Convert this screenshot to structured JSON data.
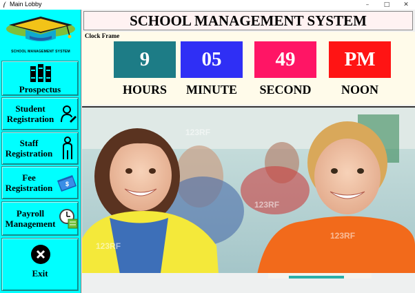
{
  "window": {
    "title": "Main Lobby",
    "minimize": "–",
    "maximize": "□",
    "close": "✕"
  },
  "logo": {
    "text": "SCHOOL MANAGEMENT SYSTEM",
    "icon": "graduation-cap-icon"
  },
  "sidebar": {
    "items": [
      {
        "label": "Prospectus",
        "icon": "books-icon"
      },
      {
        "label_line1": "Student",
        "label_line2": "Registration",
        "icon": "student-user-icon"
      },
      {
        "label_line1": "Staff",
        "label_line2": "Registration",
        "icon": "staff-person-icon"
      },
      {
        "label_line1": "Fee",
        "label_line2": "Registration",
        "icon": "money-icon"
      },
      {
        "label_line1": "Payroll",
        "label_line2": "Management",
        "icon": "clock-calendar-icon"
      },
      {
        "label": "Exit",
        "icon": "close-circle-icon"
      }
    ]
  },
  "header": {
    "title": "SCHOOL MANAGEMENT SYSTEM"
  },
  "clock": {
    "frame_title": "Clock Frame",
    "hours": "9",
    "minute": "05",
    "second": "49",
    "noon": "PM",
    "labels": {
      "hours": "HOURS",
      "minute": "MINUTE",
      "second": "SECOND",
      "noon": "NOON"
    },
    "colors": {
      "hours": "#1d7c86",
      "minute": "#2f2ff5",
      "second": "#ff1565",
      "noon": "#ff1414"
    }
  },
  "photo": {
    "watermark": "123RF",
    "description_icon": "classroom-children-photo"
  }
}
